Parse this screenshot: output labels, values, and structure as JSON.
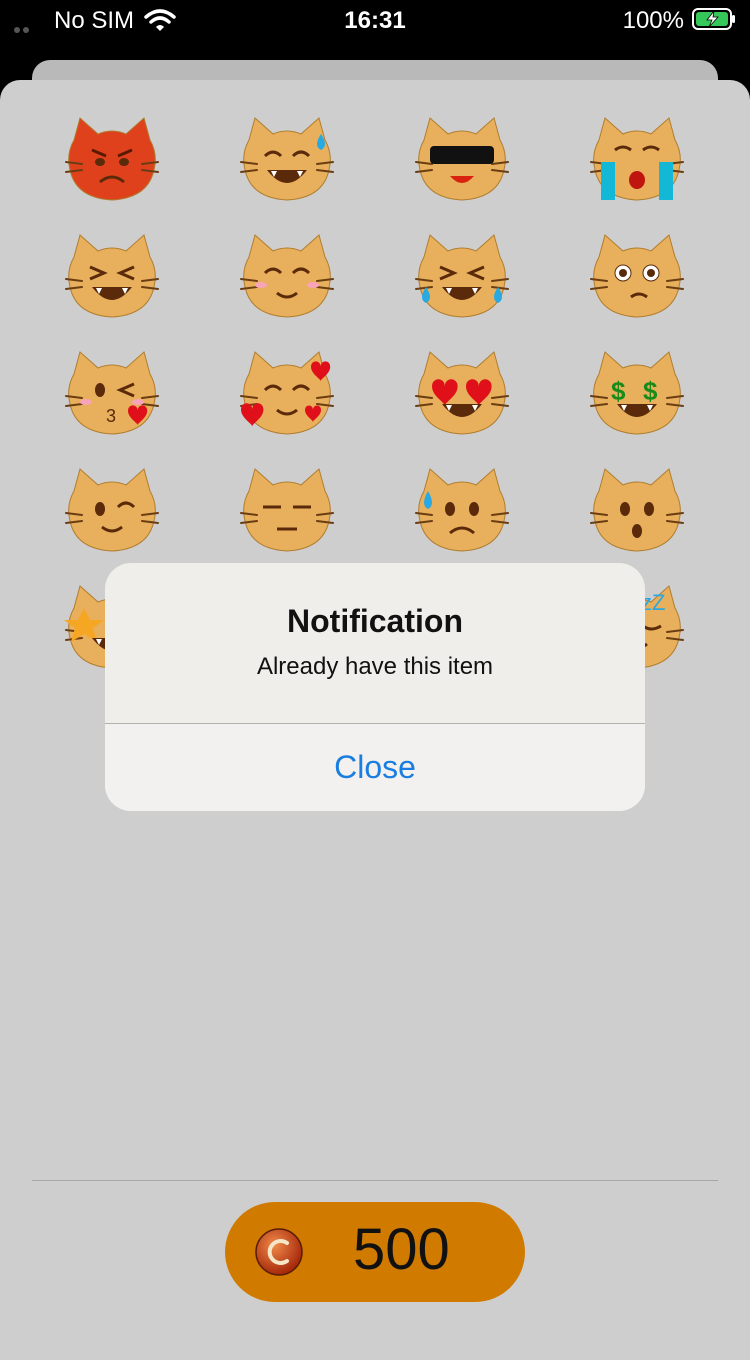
{
  "status_bar": {
    "carrier": "No SIM",
    "time": "16:31",
    "battery": "100%"
  },
  "wallet": {
    "coin_value": "500",
    "coin_icon": "coin-c-icon"
  },
  "emoji_grid": {
    "rows": [
      [
        "angry-cat-icon",
        "sweat-smile-cat-icon",
        "sunglasses-cat-icon",
        "crying-cat-icon"
      ],
      [
        "laughing-cat-icon",
        "blushing-cat-icon",
        "tears-of-joy-cat-icon",
        "worried-cat-icon"
      ],
      [
        "kissing-heart-cat-icon",
        "smiling-hearts-cat-icon",
        "heart-eyes-cat-icon",
        "money-eyes-cat-icon"
      ],
      [
        "winking-cat-icon",
        "expressionless-cat-icon",
        "anxious-sweat-cat-icon",
        "surprised-cat-icon"
      ],
      [
        "star-cat-icon",
        "sleeping-cat-icon"
      ]
    ]
  },
  "alert": {
    "title": "Notification",
    "message": "Already have this item",
    "close_label": "Close"
  },
  "colors": {
    "accent_blue": "#1a7de0",
    "coin_pill": "#d17a00",
    "sheet_bg": "#cecece"
  }
}
